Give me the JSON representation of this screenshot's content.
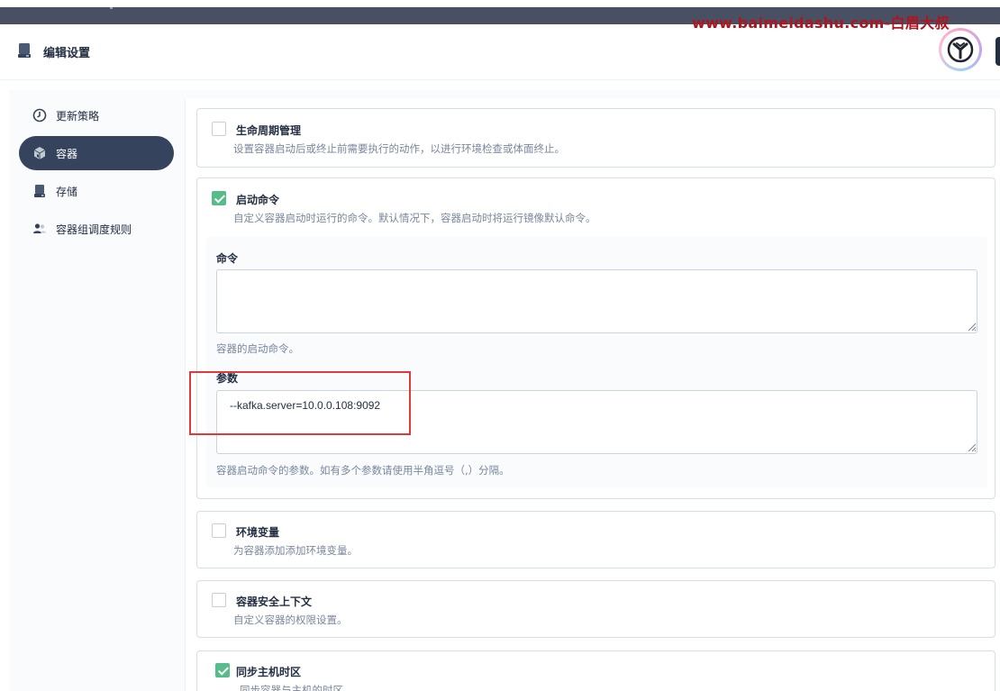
{
  "watermark": "www.baimeidashu.com-白眉大叔",
  "header": {
    "title": "编辑设置",
    "title_icon": "storage-icon",
    "avatar_icon": "avatar-logo-icon"
  },
  "sidebar": {
    "items": [
      {
        "label": "更新策略",
        "icon": "clock-icon",
        "active": false
      },
      {
        "label": "容器",
        "icon": "cube-icon",
        "active": true
      },
      {
        "label": "存储",
        "icon": "disk-icon",
        "active": false
      },
      {
        "label": "容器组调度规则",
        "icon": "users-icon",
        "active": false
      }
    ]
  },
  "sections": {
    "lifecycle": {
      "title": "生命周期管理",
      "description": "设置容器启动后或终止前需要执行的动作，以进行环境检查或体面终止。",
      "checked": false
    },
    "start_command": {
      "title": "启动命令",
      "description": "自定义容器启动时运行的命令。默认情况下，容器启动时将运行镜像默认命令。",
      "checked": true,
      "command": {
        "label": "命令",
        "value": "",
        "help": "容器的启动命令。"
      },
      "args": {
        "label": "参数",
        "value": "--kafka.server=10.0.0.108:9092",
        "help": "容器启动命令的参数。如有多个参数请使用半角逗号（,）分隔。"
      }
    },
    "env_vars": {
      "title": "环境变量",
      "description": "为容器添加添加环境变量。",
      "checked": false
    },
    "security_context": {
      "title": "容器安全上下文",
      "description": "自定义容器的权限设置。",
      "checked": false
    },
    "sync_timezone": {
      "title": "同步主机时区",
      "description": "同步容器与主机的时区。",
      "checked": true
    }
  },
  "colors": {
    "accent_green": "#55bc8a",
    "nav_active_bg": "#36435c",
    "highlight_red": "#e03a3a",
    "watermark_red": "#b0141e"
  }
}
